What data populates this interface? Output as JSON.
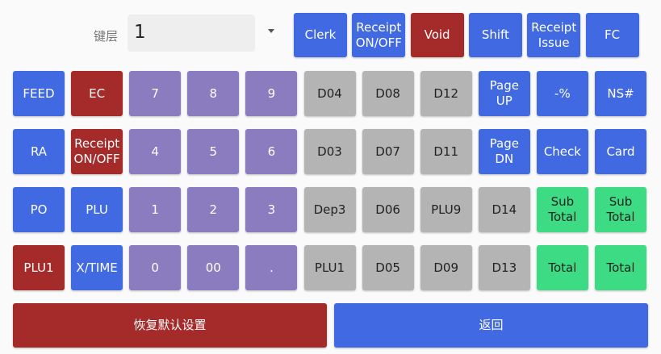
{
  "layer": {
    "label": "键层",
    "value": "1"
  },
  "top_buttons": [
    {
      "label": "Clerk",
      "color": "blue"
    },
    {
      "label": "Receipt\nON/OFF",
      "color": "blue"
    },
    {
      "label": "Void",
      "color": "red"
    },
    {
      "label": "Shift",
      "color": "blue"
    },
    {
      "label": "Receipt\nIssue",
      "color": "blue"
    },
    {
      "label": "FC",
      "color": "blue"
    }
  ],
  "grid": [
    [
      {
        "label": "FEED",
        "color": "blue"
      },
      {
        "label": "EC",
        "color": "red"
      },
      {
        "label": "7",
        "color": "purple"
      },
      {
        "label": "8",
        "color": "purple"
      },
      {
        "label": "9",
        "color": "purple"
      },
      {
        "label": "D04",
        "color": "gray"
      },
      {
        "label": "D08",
        "color": "gray"
      },
      {
        "label": "D12",
        "color": "gray"
      },
      {
        "label": "Page\nUP",
        "color": "blue"
      },
      {
        "label": "-%",
        "color": "blue"
      },
      {
        "label": "NS#",
        "color": "blue"
      }
    ],
    [
      {
        "label": "RA",
        "color": "blue"
      },
      {
        "label": "Receipt\nON/OFF",
        "color": "red"
      },
      {
        "label": "4",
        "color": "purple"
      },
      {
        "label": "5",
        "color": "purple"
      },
      {
        "label": "6",
        "color": "purple"
      },
      {
        "label": "D03",
        "color": "gray"
      },
      {
        "label": "D07",
        "color": "gray"
      },
      {
        "label": "D11",
        "color": "gray"
      },
      {
        "label": "Page\nDN",
        "color": "blue"
      },
      {
        "label": "Check",
        "color": "blue"
      },
      {
        "label": "Card",
        "color": "blue"
      }
    ],
    [
      {
        "label": "PO",
        "color": "blue"
      },
      {
        "label": "PLU",
        "color": "blue"
      },
      {
        "label": "1",
        "color": "purple"
      },
      {
        "label": "2",
        "color": "purple"
      },
      {
        "label": "3",
        "color": "purple"
      },
      {
        "label": "Dep3",
        "color": "gray"
      },
      {
        "label": "D06",
        "color": "gray"
      },
      {
        "label": "PLU9",
        "color": "gray"
      },
      {
        "label": "D14",
        "color": "gray"
      },
      {
        "label": "Sub\nTotal",
        "color": "green"
      },
      {
        "label": "Sub\nTotal",
        "color": "green"
      }
    ],
    [
      {
        "label": "PLU1",
        "color": "red"
      },
      {
        "label": "X/TIME",
        "color": "blue"
      },
      {
        "label": "0",
        "color": "purple"
      },
      {
        "label": "00",
        "color": "purple"
      },
      {
        "label": ".",
        "color": "purple"
      },
      {
        "label": "PLU1",
        "color": "gray"
      },
      {
        "label": "D05",
        "color": "gray"
      },
      {
        "label": "D09",
        "color": "gray"
      },
      {
        "label": "D13",
        "color": "gray"
      },
      {
        "label": "Total",
        "color": "green"
      },
      {
        "label": "Total",
        "color": "green"
      }
    ]
  ],
  "bottom": {
    "reset_label": "恢复默认设置",
    "back_label": "返回"
  },
  "colors": {
    "blue": "#4169e1",
    "red": "#a52a2a",
    "purple": "#8b7bbf",
    "gray": "#b4b4b4",
    "green": "#3ddc84"
  }
}
